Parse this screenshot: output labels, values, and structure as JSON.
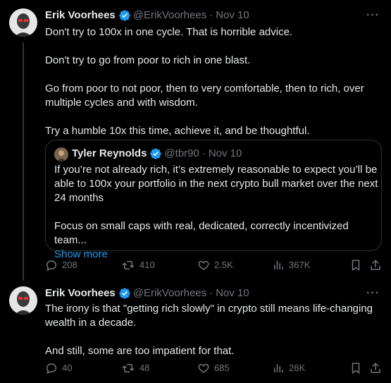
{
  "tweet1": {
    "author_name": "Erik Voorhees",
    "handle": "@ErikVoorhees",
    "separator": "·",
    "date": "Nov 10",
    "more": "···",
    "paragraphs": [
      "Don't try to 100x in one cycle. That is horrible advice.",
      "Don't try to go from poor to rich in one blast.",
      "Go from poor to not poor, then to very comfortable, then to rich, over multiple cycles and with wisdom.",
      "Try a humble 10x this time, achieve it, and be thoughtful."
    ],
    "quote": {
      "author_name": "Tyler Reynolds",
      "handle": "@tbr90",
      "separator": "·",
      "date": "Nov 10",
      "paragraphs": [
        "If you’re not already rich, it’s extremely reasonable to expect you’ll be able to 100x your portfolio in the next crypto bull market over the next 24 months",
        "Focus on small caps with real, dedicated, correctly incentivized team..."
      ],
      "show_more": "Show more"
    },
    "actions": {
      "replies": "208",
      "reposts": "410",
      "likes": "2.5K",
      "views": "367K"
    }
  },
  "tweet2": {
    "author_name": "Erik Voorhees",
    "handle": "@ErikVoorhees",
    "separator": "·",
    "date": "Nov 10",
    "more": "···",
    "paragraphs": [
      "The irony is that \"getting rich slowly\" in crypto still means life-changing wealth in a decade.",
      "And still, some are too impatient for that."
    ],
    "actions": {
      "replies": "40",
      "reposts": "48",
      "likes": "685",
      "views": "26K"
    }
  },
  "colors": {
    "background": "#000000",
    "text": "#e7e9ea",
    "muted": "#71767b",
    "accent": "#1d9bf0",
    "border": "#2f3336"
  },
  "icons": [
    "verified-badge-icon",
    "more-icon",
    "reply-icon",
    "repost-icon",
    "like-icon",
    "views-icon",
    "bookmark-icon",
    "share-icon"
  ]
}
